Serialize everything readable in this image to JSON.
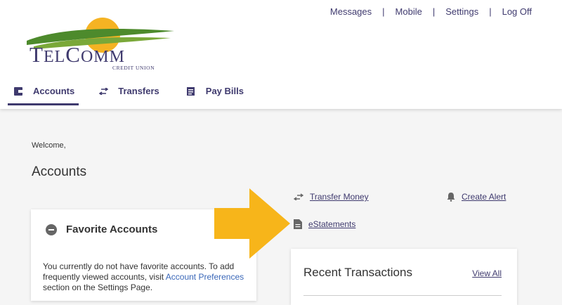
{
  "header": {
    "top_links": [
      {
        "label": "Messages"
      },
      {
        "label": "Mobile"
      },
      {
        "label": "Settings"
      },
      {
        "label": "Log Off"
      }
    ],
    "separator": "|",
    "logo": {
      "name": "TelComm",
      "subtitle": "CREDIT UNION"
    },
    "nav": [
      {
        "label": "Accounts",
        "icon": "wallet-icon",
        "active": true
      },
      {
        "label": "Transfers",
        "icon": "transfer-arrows-icon",
        "active": false
      },
      {
        "label": "Pay Bills",
        "icon": "bill-icon",
        "active": false
      }
    ]
  },
  "main": {
    "welcome": "Welcome,",
    "title": "Accounts",
    "quick_links": {
      "transfer_money": "Transfer Money",
      "create_alert": "Create Alert",
      "estatements": "eStatements"
    },
    "favorite_accounts": {
      "heading": "Favorite Accounts",
      "message_before": "You currently do not have favorite accounts. To add frequently viewed accounts, visit ",
      "link": "Account Preferences",
      "message_after": " section on the Settings Page."
    },
    "recent_transactions": {
      "heading": "Recent Transactions",
      "view_all": "View All"
    }
  },
  "colors": {
    "brand": "#3f3a6e",
    "link": "#3a67b8",
    "arrow": "#f7b51a",
    "logo_green": "#4d8a2c",
    "logo_sun": "#f5b323"
  }
}
